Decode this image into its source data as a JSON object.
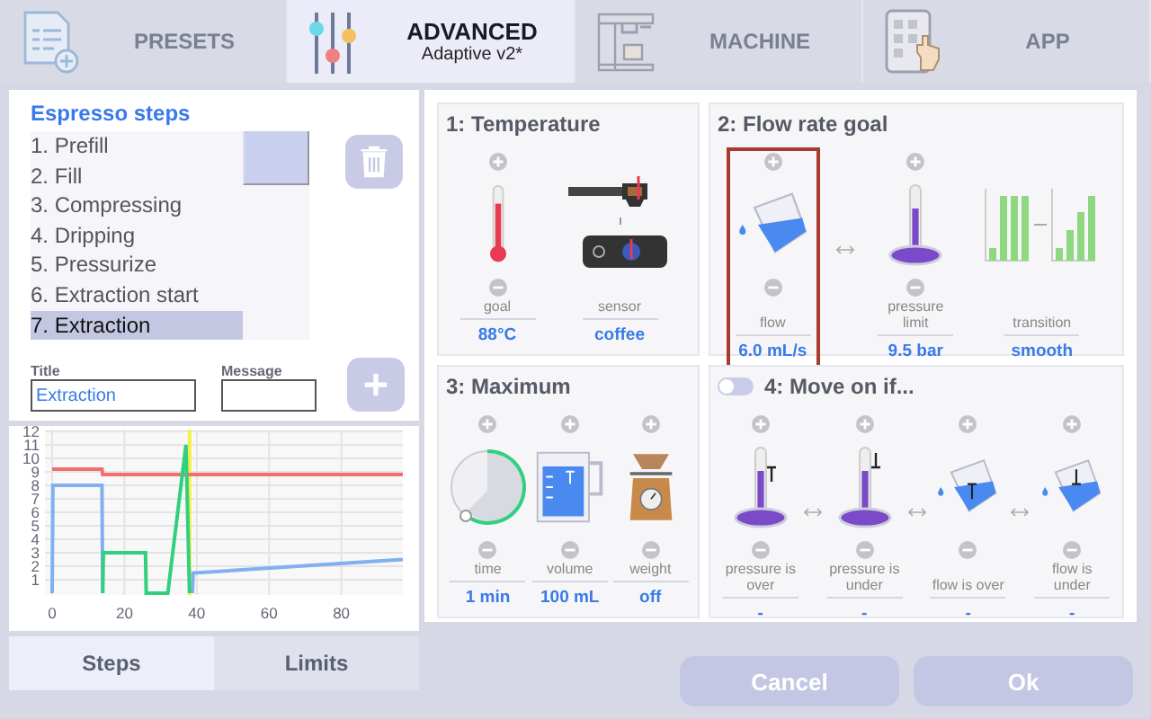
{
  "tabs": [
    {
      "kind": "presets",
      "label": "PRESETS",
      "selected": false
    },
    {
      "kind": "advanced",
      "label": "ADVANCED",
      "sublabel": "Adaptive v2*",
      "selected": true
    },
    {
      "kind": "machine",
      "label": "MACHINE",
      "selected": false
    },
    {
      "kind": "app",
      "label": "APP",
      "selected": false
    }
  ],
  "steps": {
    "title": "Espresso steps",
    "items": [
      {
        "label": "1. Prefill",
        "selected": false
      },
      {
        "label": "2. Fill",
        "selected": false
      },
      {
        "label": "3. Compressing",
        "selected": false
      },
      {
        "label": "4. Dripping",
        "selected": false
      },
      {
        "label": "5. Pressurize",
        "selected": false
      },
      {
        "label": "6. Extraction start",
        "selected": false
      },
      {
        "label": "7. Extraction",
        "selected": true
      }
    ],
    "title_field": {
      "label": "Title",
      "value": "Extraction"
    },
    "message_field": {
      "label": "Message"
    }
  },
  "chart_data": {
    "type": "line",
    "x": [
      0,
      0.2,
      13.8,
      14,
      14.2,
      25.8,
      26,
      32,
      37,
      38,
      38.8,
      39,
      97
    ],
    "xlim": [
      0,
      97
    ],
    "ylim": [
      0,
      12
    ],
    "xticks": [
      0,
      20,
      40,
      60,
      80
    ],
    "yticks": [
      1,
      2,
      3,
      4,
      5,
      6,
      7,
      8,
      9,
      10,
      11,
      12
    ],
    "grid": true,
    "series": [
      {
        "color": "#f07070",
        "values": [
          9.2,
          9.2,
          9.2,
          8.8,
          8.8,
          8.8,
          8.8,
          8.8,
          8.8,
          8.8,
          8.8,
          8.8,
          8.8
        ]
      },
      {
        "color": "#80b0f0",
        "values": [
          0,
          8,
          8,
          0,
          null,
          null,
          null,
          null,
          null,
          null,
          0,
          1.5,
          2.5
        ]
      },
      {
        "color": "#30d080",
        "values": [
          null,
          null,
          null,
          0,
          3,
          3,
          0,
          0,
          11,
          0,
          null,
          null,
          null
        ]
      }
    ],
    "bands": [
      {
        "axis": "x",
        "from": 37.5,
        "to": 38.5,
        "color": "#f4f040"
      }
    ]
  },
  "bottom_tabs": [
    {
      "label": "Steps",
      "selected": true
    },
    {
      "label": "Limits",
      "selected": false
    }
  ],
  "cards": [
    {
      "title": "1: Temperature",
      "params": [
        {
          "kind": "thermometer",
          "label": "goal",
          "value": "88°C",
          "adjustable": true,
          "selected": false,
          "linked_next": false
        },
        {
          "kind": "sensor",
          "label": "sensor",
          "value": "coffee",
          "adjustable": false,
          "selected": false,
          "linked_next": false
        }
      ]
    },
    {
      "title": "2: Flow rate goal",
      "params": [
        {
          "kind": "pitcher",
          "label": "flow",
          "value": "6.0 mL/s",
          "adjustable": true,
          "selected": true,
          "linked_next": true
        },
        {
          "kind": "manometer",
          "label": "pressure limit",
          "value": "9.5 bar",
          "adjustable": true,
          "selected": false,
          "linked_next": false
        },
        {
          "kind": "bars",
          "label": "transition",
          "value": "smooth",
          "adjustable": false,
          "selected": false,
          "linked_next": false
        }
      ]
    },
    {
      "title": "3: Maximum",
      "params": [
        {
          "kind": "timer",
          "label": "time",
          "value": "1 min",
          "adjustable": true,
          "selected": false,
          "linked_next": false
        },
        {
          "kind": "beaker",
          "label": "volume",
          "value": "100 mL",
          "adjustable": true,
          "selected": false,
          "linked_next": false
        },
        {
          "kind": "scale",
          "label": "weight",
          "value": "off",
          "adjustable": true,
          "selected": false,
          "linked_next": false
        }
      ]
    },
    {
      "title": "4: Move on if...",
      "toggle": {
        "on": false
      },
      "params": [
        {
          "kind": "manometer-over",
          "label": "pressure is over",
          "value": "-",
          "adjustable": true,
          "selected": false,
          "linked_next": true
        },
        {
          "kind": "manometer-under",
          "label": "pressure is under",
          "value": "-",
          "adjustable": true,
          "selected": false,
          "linked_next": true
        },
        {
          "kind": "pitcher-over",
          "label": "flow is over",
          "value": "-",
          "adjustable": true,
          "selected": false,
          "linked_next": true
        },
        {
          "kind": "pitcher-under",
          "label": "flow is under",
          "value": "-",
          "adjustable": true,
          "selected": false,
          "linked_next": false
        }
      ]
    }
  ],
  "buttons": [
    {
      "label": "Cancel"
    },
    {
      "label": "Ok"
    }
  ]
}
